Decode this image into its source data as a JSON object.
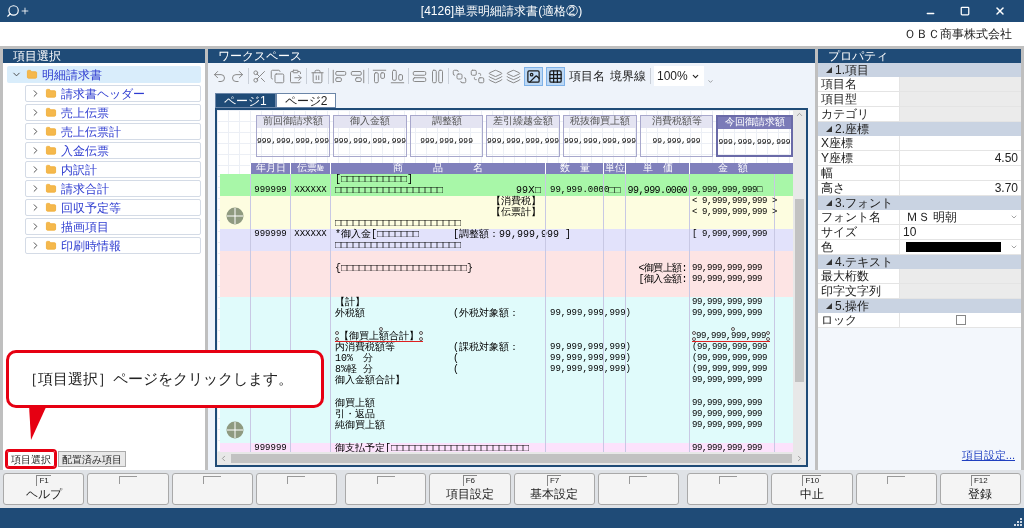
{
  "window": {
    "title": "[4126]単票明細請求書(適格②)",
    "company": "ＯＢＣ商事株式会社"
  },
  "item_panel": {
    "title": "項目選択",
    "tree": [
      {
        "label": "明細請求書",
        "expanded": true,
        "selected": true,
        "children": [
          {
            "label": "請求書ヘッダー",
            "expanded": false,
            "selected": false
          },
          {
            "label": "売上伝票",
            "expanded": false,
            "selected": false
          },
          {
            "label": "売上伝票計",
            "expanded": false,
            "selected": false
          },
          {
            "label": "入金伝票",
            "expanded": false,
            "selected": false
          },
          {
            "label": "内訳計",
            "expanded": false,
            "selected": false
          },
          {
            "label": "請求合計",
            "expanded": false,
            "selected": false
          },
          {
            "label": "回収予定等",
            "expanded": false,
            "selected": false
          },
          {
            "label": "描画項目",
            "expanded": false,
            "selected": false
          },
          {
            "label": "印刷時情報",
            "expanded": false,
            "selected": false
          }
        ]
      }
    ],
    "tabs": [
      {
        "label": "項目選択",
        "selected": true
      },
      {
        "label": "配置済み項目",
        "selected": false
      }
    ]
  },
  "workspace": {
    "title": "ワークスペース",
    "toolbar": {
      "toggles": [
        {
          "kind": "image",
          "selected": true
        },
        {
          "kind": "grid",
          "selected": true
        }
      ],
      "text_buttons": [
        "項目名",
        "境界線"
      ],
      "zoom": "100%"
    },
    "tabs": [
      {
        "label": "ページ1",
        "selected": true
      },
      {
        "label": "ページ2",
        "selected": false
      }
    ],
    "document": {
      "summary": [
        {
          "label": "前回御請求額",
          "value": "999,999,999,999",
          "kind": "normal"
        },
        {
          "label": "御入金額",
          "value": "999,999,999,999",
          "kind": "normal"
        },
        {
          "label": "調整額",
          "value": "999,999,999",
          "kind": "normal"
        },
        {
          "label": "差引繰越金額",
          "value": "999,999,999,999",
          "kind": "normal"
        },
        {
          "label": "税抜御買上額",
          "value": "999,999,999,999",
          "kind": "normal"
        },
        {
          "label": "消費税額等",
          "value": "99,999,999",
          "kind": "normal"
        },
        {
          "label": "今回御請求額",
          "value": "999,999,999,999",
          "kind": "total"
        }
      ],
      "columns": {
        "date": "年月日",
        "slip": "伝票№",
        "name": "商　　　品　　　名",
        "qty": "数　量",
        "unit": "単位",
        "price": "単　価",
        "amount": "金　額"
      },
      "bands": [
        {
          "color": "#a8f7a8",
          "handle": false,
          "rows": [
            {
              "name": "[□□□□□□□□□□□]",
              "selected": false
            },
            {
              "date": "999999",
              "slip": "XXXXXX",
              "name": "□□□□□□□□□□□□□□□□□□",
              "tail": "99Ⅹ□",
              "qty": "99,999.0000",
              "unit": "□□",
              "price": "99,999.0000",
              "amount": "9,999,999,999□",
              "selected": false
            }
          ]
        },
        {
          "color": "#fdfde0",
          "handle": true,
          "rows": [
            {
              "tail": "【消費税】",
              "amount": "< 9,999,999,999 >",
              "selected": false
            },
            {
              "tail": "【伝票計】",
              "amount": "< 9,999,999,999 >",
              "selected": false
            },
            {
              "name": "□□□□□□□□□□□□□□□□□□□□□",
              "selected": false
            }
          ]
        },
        {
          "color": "#e2e2fb",
          "handle": false,
          "rows": [
            {
              "date": "999999",
              "slip": "XXXXXX",
              "name": "*御入金[□□□□□□□",
              "mid": "[調整額：99,999,999 ]",
              "amount": "[ 9,999,999,999",
              "selected": false
            },
            {
              "name": "□□□□□□□□□□□□□□□□□□□□□",
              "selected": false
            }
          ]
        },
        {
          "color": "#fde4e4",
          "handle": false,
          "rows": [
            {
              "kind": "blank"
            },
            {
              "name": "{□□□□□□□□□□□□□□□□□□□□□}",
              "price": "<御買上額:",
              "amount": "99,999,999,999",
              "selected": false
            },
            {
              "price": "[御入金額:",
              "amount": "99,999,999,999",
              "selected": false
            },
            {
              "kind": "blank"
            }
          ]
        },
        {
          "color": "#e0fbfb",
          "handle": true,
          "rows": [
            {
              "name": "【計】",
              "amount": "99,999,999,999",
              "selected": false
            },
            {
              "name": "外税額",
              "mid": "(外税対象額：",
              "qty": "99,999,999,999)",
              "amount": "99,999,999,999",
              "selected": false
            },
            {
              "kind": "blank"
            },
            {
              "name": "【御買上額合計】",
              "amount": "99,999,999,999",
              "selected": true
            },
            {
              "name": "内消費税額等",
              "mid": "(課税対象額：",
              "qty": "99,999,999,999)",
              "amount": "(99,999,999,999",
              "selected": false
            },
            {
              "name": "10%　分",
              "mid": "(",
              "qty": "99,999,999,999)",
              "amount": "(99,999,999,999",
              "selected": false
            },
            {
              "name": "8%軽 分",
              "mid": "(",
              "qty": "99,999,999,999)",
              "amount": "(99,999,999,999",
              "selected": false
            },
            {
              "name": "御入金額合計】",
              "amount": "99,999,999,999",
              "selected": false
            },
            {
              "kind": "blank"
            },
            {
              "name": "御買上額",
              "amount": "99,999,999,999",
              "selected": false
            },
            {
              "name": "引・返品",
              "amount": "99,999,999,999",
              "selected": false
            },
            {
              "name": "純御買上額",
              "amount": "99,999,999,999",
              "selected": false
            },
            {
              "kind": "blank"
            }
          ]
        },
        {
          "color": "#fce2fc",
          "handle": false,
          "rows": [
            {
              "date": "999999",
              "name": "御支払予定[□□□□□□□□□□□□□□□□□□□□□□□",
              "amount": "99,999,999,999",
              "selected": false
            }
          ]
        }
      ]
    }
  },
  "properties": {
    "title": "プロパティ",
    "link": "項目設定...",
    "sections": [
      {
        "title": "1.項目",
        "expanded": true,
        "rows": [
          {
            "label": "項目名",
            "kind": "text",
            "disabled": true
          },
          {
            "label": "項目型",
            "kind": "text",
            "disabled": true
          },
          {
            "label": "カテゴリ",
            "kind": "text",
            "disabled": true
          }
        ]
      },
      {
        "title": "2.座標",
        "expanded": true,
        "rows": [
          {
            "label": "X座標",
            "kind": "number",
            "disabled": false
          },
          {
            "label": "Y座標",
            "kind": "number",
            "value": "4.50",
            "disabled": false
          },
          {
            "label": "幅",
            "kind": "number",
            "disabled": false
          },
          {
            "label": "高さ",
            "kind": "number",
            "value": "3.70",
            "disabled": false
          }
        ]
      },
      {
        "title": "3.フォント",
        "expanded": true,
        "rows": [
          {
            "label": "フォント名",
            "kind": "select",
            "value": "ＭＳ 明朝",
            "disabled": false
          },
          {
            "label": "サイズ",
            "kind": "text",
            "value": "10",
            "disabled": false
          },
          {
            "label": "色",
            "kind": "color",
            "color": "#000000",
            "disabled": false
          }
        ]
      },
      {
        "title": "4.テキスト",
        "expanded": true,
        "rows": [
          {
            "label": "最大桁数",
            "kind": "text",
            "disabled": true
          },
          {
            "label": "印字文字列",
            "kind": "text",
            "disabled": true
          }
        ]
      },
      {
        "title": "5.操作",
        "expanded": true,
        "rows": [
          {
            "label": "ロック",
            "kind": "checkbox",
            "checked": false,
            "disabled": false
          }
        ]
      }
    ]
  },
  "function_keys": [
    {
      "kind": "key",
      "key": "F1",
      "label": "ヘルプ"
    },
    {
      "kind": "blank"
    },
    {
      "kind": "blank"
    },
    {
      "kind": "blank"
    },
    {
      "kind": "blank"
    },
    {
      "kind": "key",
      "key": "F6",
      "label": "項目設定"
    },
    {
      "kind": "key",
      "key": "F7",
      "label": "基本設定"
    },
    {
      "kind": "blank"
    },
    {
      "kind": "blank"
    },
    {
      "kind": "key",
      "key": "F10",
      "label": "中止"
    },
    {
      "kind": "blank"
    },
    {
      "kind": "key",
      "key": "F12",
      "label": "登録"
    }
  ],
  "callout": {
    "text": "［項目選択］ページをクリックします。"
  }
}
